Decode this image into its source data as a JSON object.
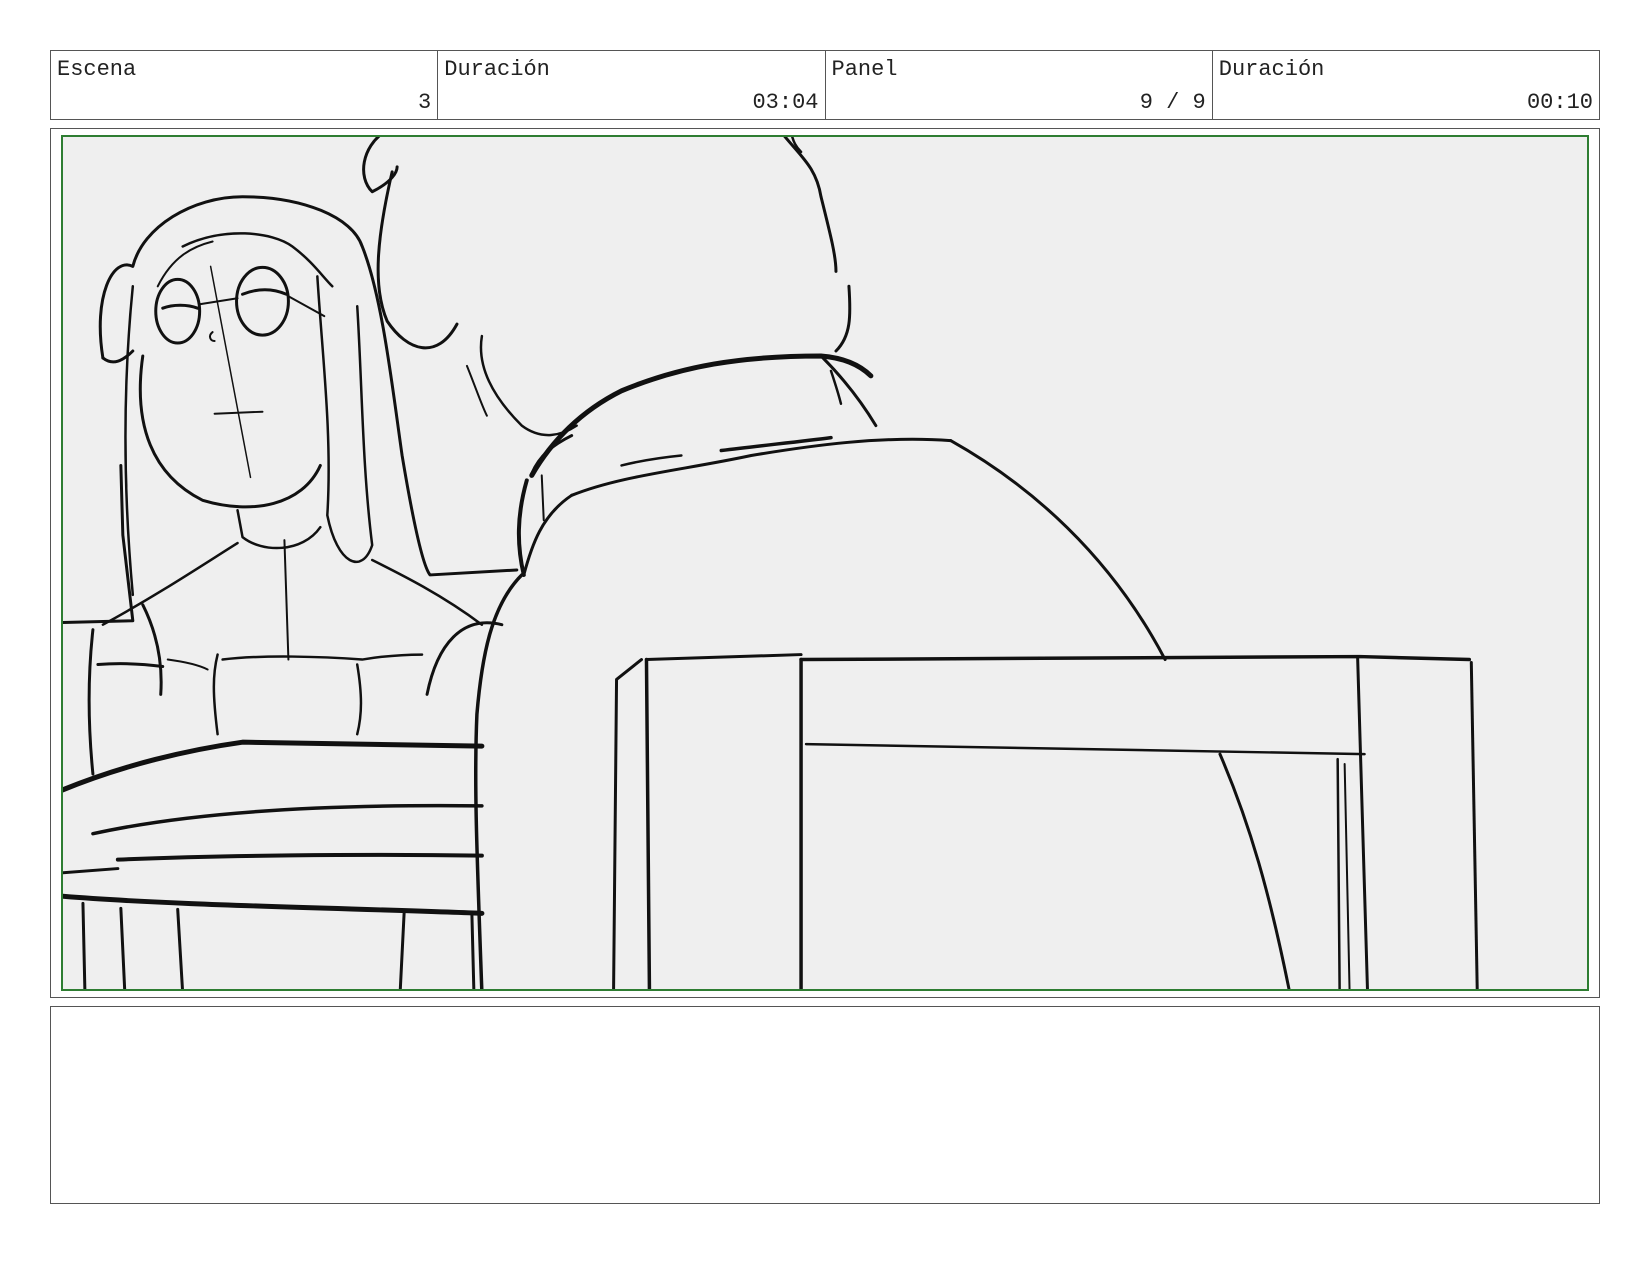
{
  "header": {
    "scene_label": "Escena",
    "scene_value": "3",
    "scene_duration_label": "Duración",
    "scene_duration_value": "03:04",
    "panel_label": "Panel",
    "panel_value": "9 / 9",
    "panel_duration_label": "Duración",
    "panel_duration_value": "00:10"
  },
  "panel": {
    "frame_color": "#2e7d32",
    "background_color": "#efefef",
    "drawing": "storyboard-sketch-woman-with-glasses-and-figure-at-table"
  },
  "notes": {
    "text": ""
  }
}
